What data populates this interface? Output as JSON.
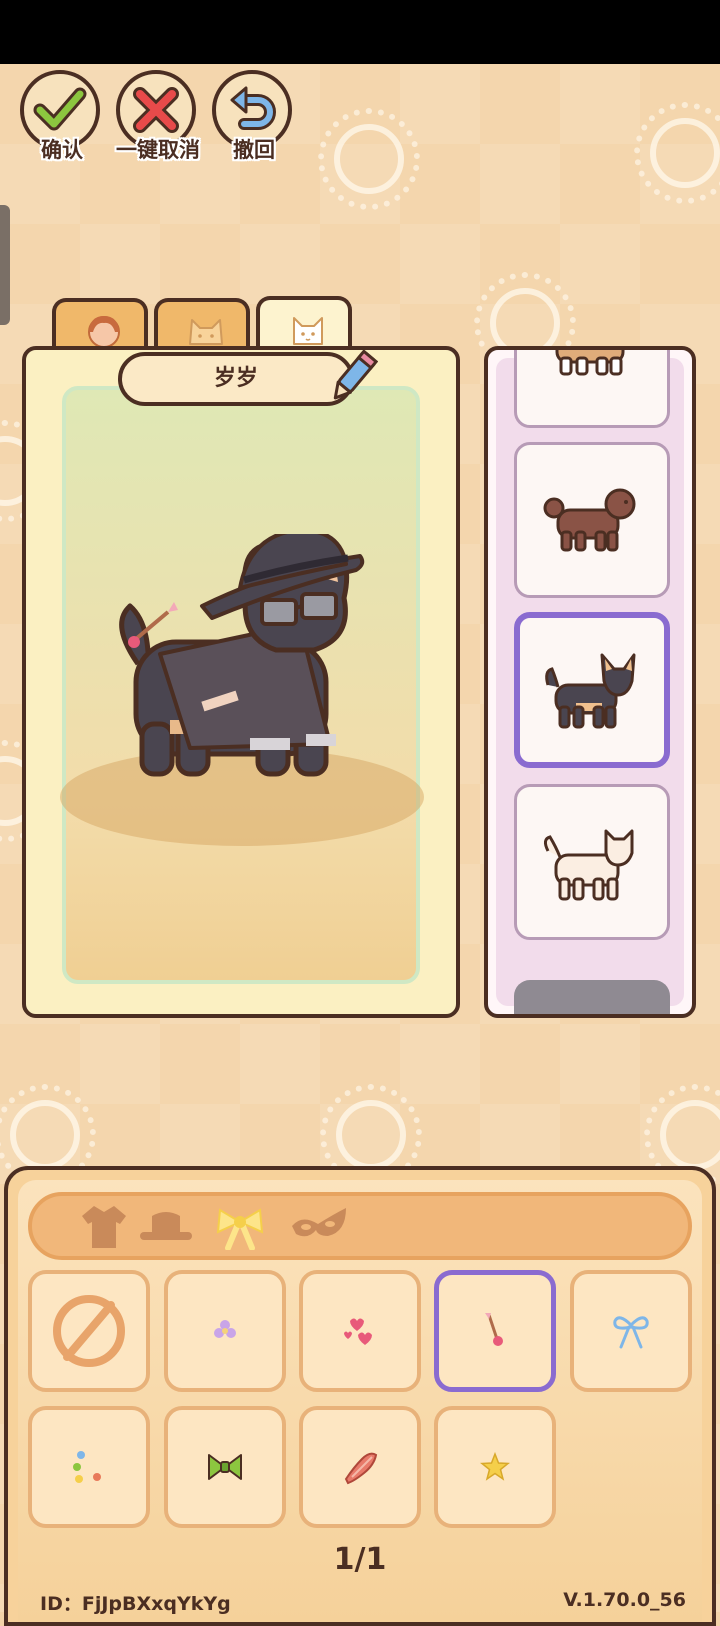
{
  "toolbar": {
    "confirm_label": "确认",
    "cancel_all_label": "一键取消",
    "undo_label": "撤回"
  },
  "category_tabs": [
    {
      "icon": "person-face-icon",
      "selected": false
    },
    {
      "icon": "cat-face-icon",
      "selected": false
    },
    {
      "icon": "dog-face-icon",
      "selected": true
    }
  ],
  "pet": {
    "name": "岁岁",
    "breed_selected_index": 2
  },
  "breeds": [
    {
      "icon": "corgi-dog-icon"
    },
    {
      "icon": "poodle-dog-icon"
    },
    {
      "icon": "chihuahua-black-tan-icon"
    },
    {
      "icon": "white-spitz-dog-icon"
    }
  ],
  "accessory_tabs": [
    {
      "icon": "shirt-icon",
      "selected": false
    },
    {
      "icon": "hat-icon",
      "selected": false
    },
    {
      "icon": "bow-icon",
      "selected": true
    },
    {
      "icon": "mask-icon",
      "selected": false
    }
  ],
  "accessories": [
    {
      "icon": "none-icon",
      "selected": false
    },
    {
      "icon": "purple-flower-clip-icon",
      "selected": false
    },
    {
      "icon": "hearts-icon",
      "selected": false
    },
    {
      "icon": "cupid-arrow-icon",
      "selected": true
    },
    {
      "icon": "blue-ribbon-icon",
      "selected": false
    },
    {
      "icon": "flower-sprinkles-icon",
      "selected": false
    },
    {
      "icon": "green-bow-tie-icon",
      "selected": false
    },
    {
      "icon": "bacon-clip-icon",
      "selected": false
    },
    {
      "icon": "star-clip-icon",
      "selected": false
    }
  ],
  "pager": "1/1",
  "footer": {
    "id_text": "ID：FjJpBXxqYkYg",
    "version": "V.1.70.0_56"
  },
  "colors": {
    "outline": "#4b2e22",
    "selection": "#8a6bd0",
    "background": "#f4d6ad"
  }
}
